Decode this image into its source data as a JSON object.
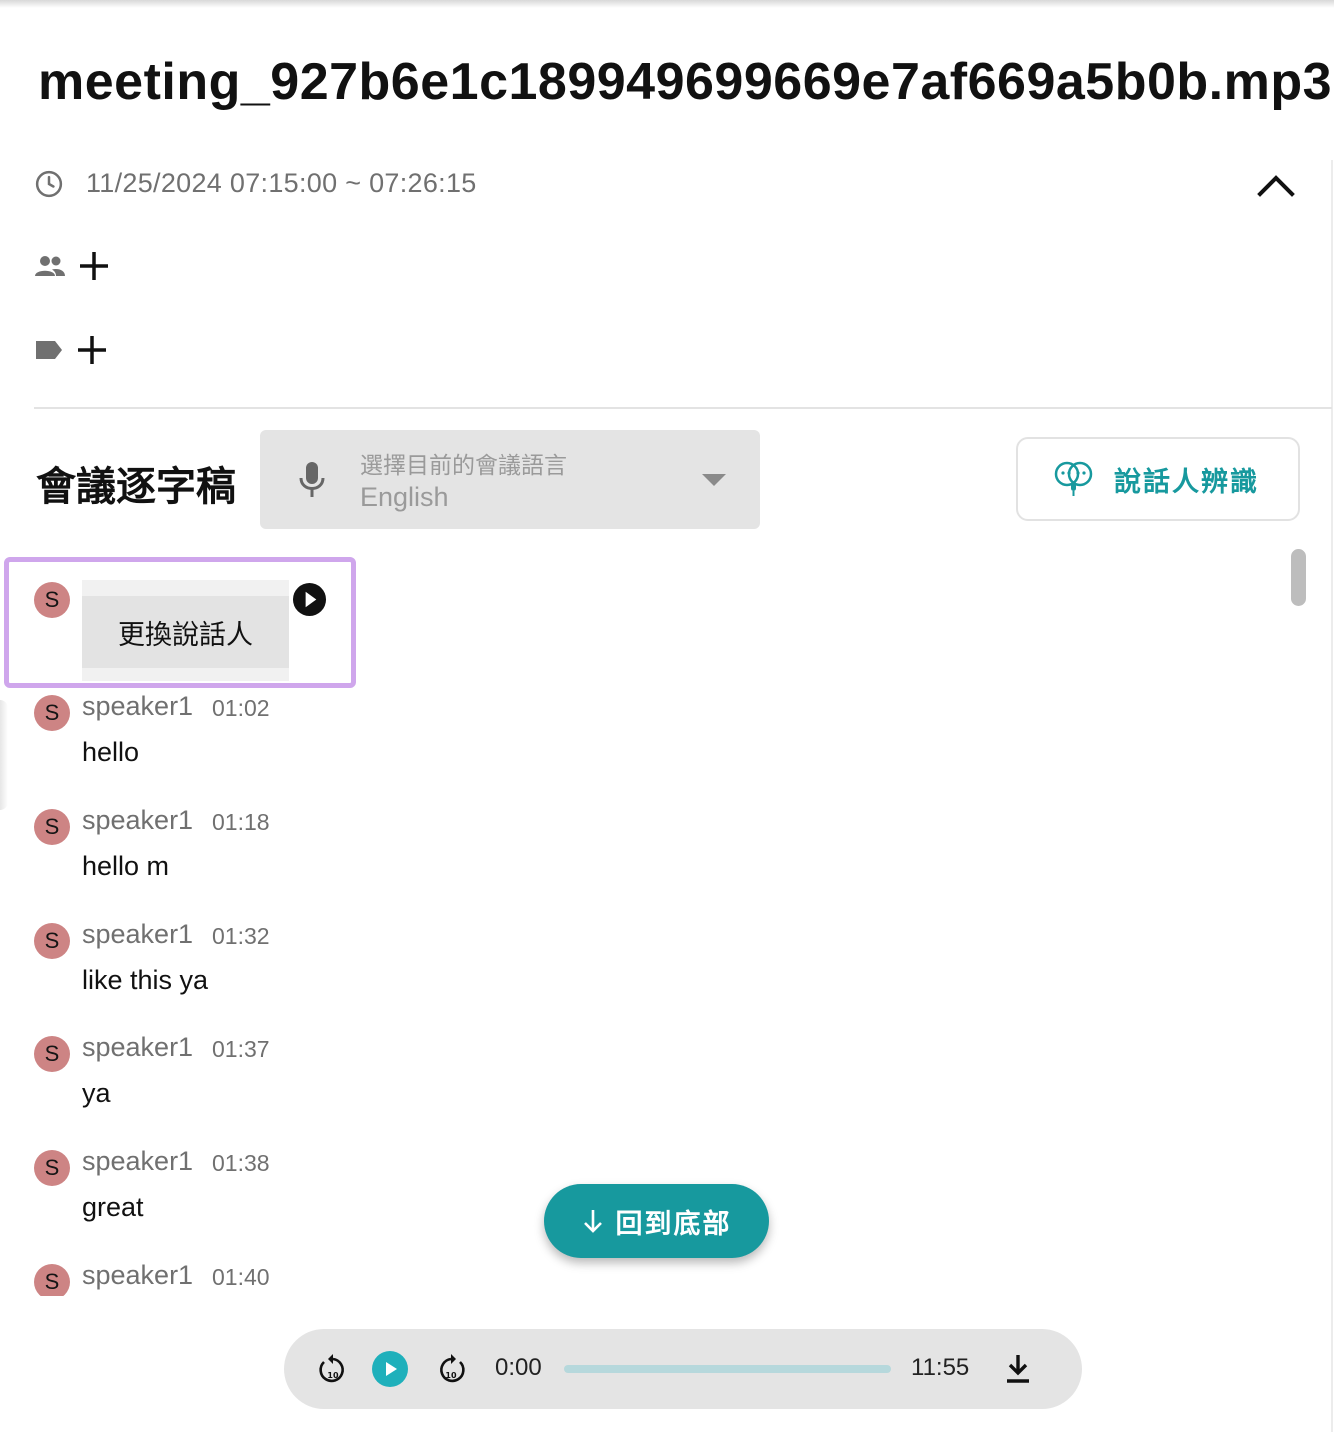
{
  "file": {
    "title": "meeting_927b6e1c189949699669e7af669a5b0b.mp3"
  },
  "meta": {
    "time_range": "11/25/2024 07:15:00 ~ 07:26:15"
  },
  "icons": {
    "clock": "clock-icon",
    "collapse": "chevron-up-icon",
    "people": "people-icon",
    "tag": "tag-icon",
    "add": "plus-icon",
    "mic": "microphone-icon",
    "speaker_id": "speaker-identify-icon",
    "play": "play-icon",
    "arrow_down": "arrow-down-icon",
    "rewind": "replay-10-icon",
    "forward": "forward-10-icon",
    "download": "download-icon"
  },
  "transcript": {
    "title": "會議逐字稿",
    "language_select": {
      "label": "選擇目前的會議語言",
      "value": "English"
    },
    "speaker_id_button": "說話人辨識",
    "context_menu": {
      "avatar": "S",
      "item": "更換說話人"
    },
    "entries": [
      {
        "avatar": "S",
        "speaker": "speaker1",
        "time": "01:02",
        "text": "hello"
      },
      {
        "avatar": "S",
        "speaker": "speaker1",
        "time": "01:18",
        "text": "hello m"
      },
      {
        "avatar": "S",
        "speaker": "speaker1",
        "time": "01:32",
        "text": "like this ya"
      },
      {
        "avatar": "S",
        "speaker": "speaker1",
        "time": "01:37",
        "text": "ya"
      },
      {
        "avatar": "S",
        "speaker": "speaker1",
        "time": "01:38",
        "text": "great"
      },
      {
        "avatar": "S",
        "speaker": "speaker1",
        "time": "01:40",
        "text": ""
      }
    ],
    "back_to_bottom": "回到底部"
  },
  "player": {
    "current": "0:00",
    "duration": "11:55",
    "progress": 0
  },
  "colors": {
    "accent": "#17999e",
    "avatar": "#cd8484",
    "highlight": "#cfa6ec",
    "progress_track": "#b6d8dc"
  }
}
